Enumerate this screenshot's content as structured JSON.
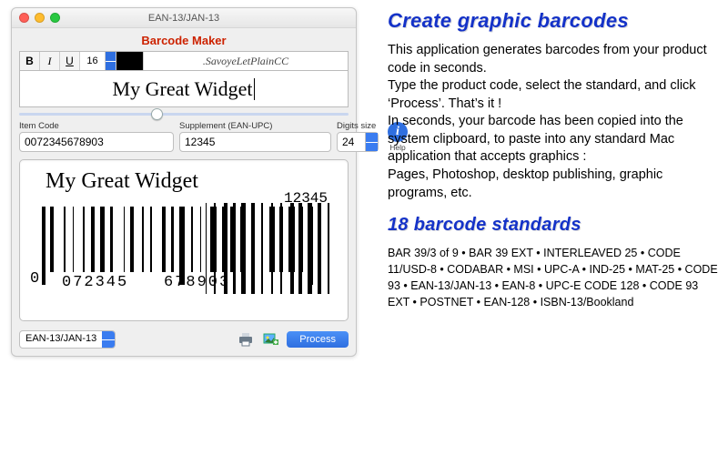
{
  "window": {
    "title": "EAN-13/JAN-13",
    "app_title": "Barcode Maker"
  },
  "fontbar": {
    "bold": "B",
    "italic": "I",
    "underline": "U",
    "size": "16",
    "font_name": ".SavoyeLetPlainCC"
  },
  "title_text": "My Great Widget",
  "fields": {
    "item_code_label": "Item Code",
    "item_code_value": "0072345678903",
    "supplement_label": "Supplement (EAN-UPC)",
    "supplement_value": "12345",
    "digits_label": "Digits size",
    "digits_value": "24",
    "help_label": "Help"
  },
  "preview": {
    "title": "My Great Widget",
    "supplement": "12345",
    "lead_digit": "0",
    "group1": "072345",
    "group2": "678903"
  },
  "bottom": {
    "standard_selected": "EAN-13/JAN-13",
    "process_label": "Process"
  },
  "marketing": {
    "heading1": "Create graphic barcodes",
    "body": "This application generates barcodes from your product code in seconds.\nType the product code, select the standard, and click ‘Process’. That’s it !\nIn seconds, your barcode has been copied into the system clipboard, to paste into any standard Mac application that accepts graphics :\nPages, Photoshop, desktop publishing, graphic programs, etc.",
    "heading2": "18 barcode standards",
    "standards": "BAR 39/3 of 9 • BAR 39 EXT • INTERLEAVED 25 • CODE 11/USD-8 • CODABAR • MSI • UPC-A • IND-25 • MAT-25 • CODE 93 • EAN-13/JAN-13 • EAN-8 • UPC-E CODE 128 • CODE 93 EXT • POSTNET • EAN-128 • ISBN-13/Bookland"
  }
}
